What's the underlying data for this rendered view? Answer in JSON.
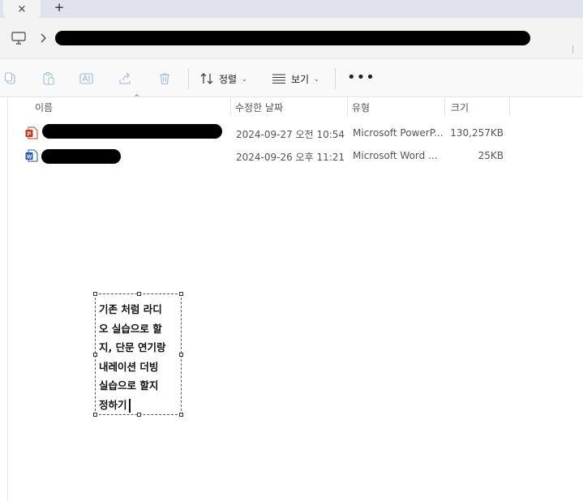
{
  "tabbar": {
    "close_glyph": "×",
    "new_tab_glyph": "+"
  },
  "toolbar": {
    "sort_label": "정렬",
    "view_label": "보기",
    "more_label": "•••"
  },
  "columns": {
    "name": "이름",
    "modified": "수정한 날짜",
    "type": "유형",
    "size": "크기"
  },
  "files": [
    {
      "icon": "powerpoint-file-icon",
      "modified": "2024-09-27 오전 10:54",
      "type": "Microsoft PowerP...",
      "size": "130,257KB"
    },
    {
      "icon": "word-file-icon",
      "modified": "2024-09-26 오후 11:21",
      "type": "Microsoft Word ...",
      "size": "25KB"
    }
  ],
  "note": {
    "text": "기존 처럼 라디\n오 실습으로 할\n지, 단문 연기랑\n내레이션 더빙\n실습으로 할지\n정하기"
  },
  "colors": {
    "tabbar_bg": "#dfe4ec",
    "address_bg": "#f3f3f3",
    "toolbar_bg": "#f9f9f9",
    "ppt_red": "#c43e1c",
    "word_blue": "#185abd"
  }
}
